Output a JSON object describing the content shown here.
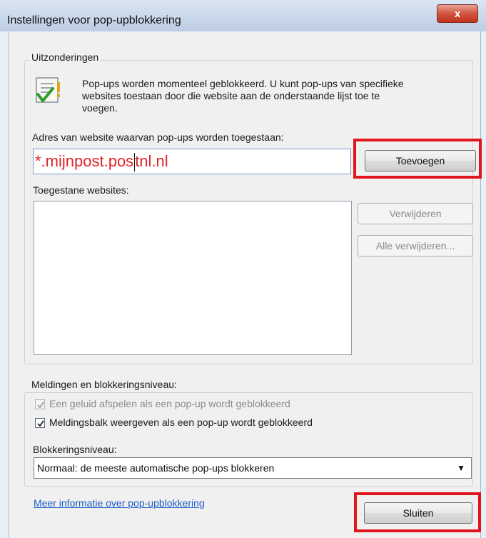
{
  "window": {
    "title": "Instellingen voor pop-upblokkering",
    "close_label": "x"
  },
  "exceptions": {
    "group_label": "Uitzonderingen",
    "info_text_lines": [
      "Pop-ups worden momenteel geblokkeerd. U kunt pop-ups van specifieke",
      "websites toestaan door die website aan de onderstaande lijst toe te",
      "voegen."
    ],
    "address_label": "Adres van website waarvan pop-ups worden toegestaan:",
    "address_value_before_caret": "*.mijnpost.pos",
    "address_value_after_caret": "tnl.nl",
    "add_button": "Toevoegen",
    "allowed_label": "Toegestane websites:",
    "allowed_sites": [],
    "remove_button": "Verwijderen",
    "remove_all_button": "Alle verwijderen..."
  },
  "notifications": {
    "group_label": "Meldingen en blokkeringsniveau:",
    "play_sound_label": "Een geluid afspelen als een pop-up wordt geblokkeerd",
    "play_sound_checked": true,
    "play_sound_disabled": true,
    "show_bar_label": "Meldingsbalk weergeven als een pop-up wordt geblokkeerd",
    "show_bar_checked": true,
    "level_label": "Blokkeringsniveau:",
    "level_value": "Normaal: de meeste automatische pop-ups blokkeren"
  },
  "footer": {
    "more_info_link": "Meer informatie over pop-upblokkering",
    "close_button": "Sluiten"
  },
  "colors": {
    "highlight_red": "#e0161c",
    "input_text_red": "#e0242a",
    "link_blue": "#1c5cc7"
  },
  "icons": {
    "info": "checklist-icon",
    "close": "close-icon",
    "dropdown": "chevron-down-icon",
    "check": "check-icon"
  }
}
